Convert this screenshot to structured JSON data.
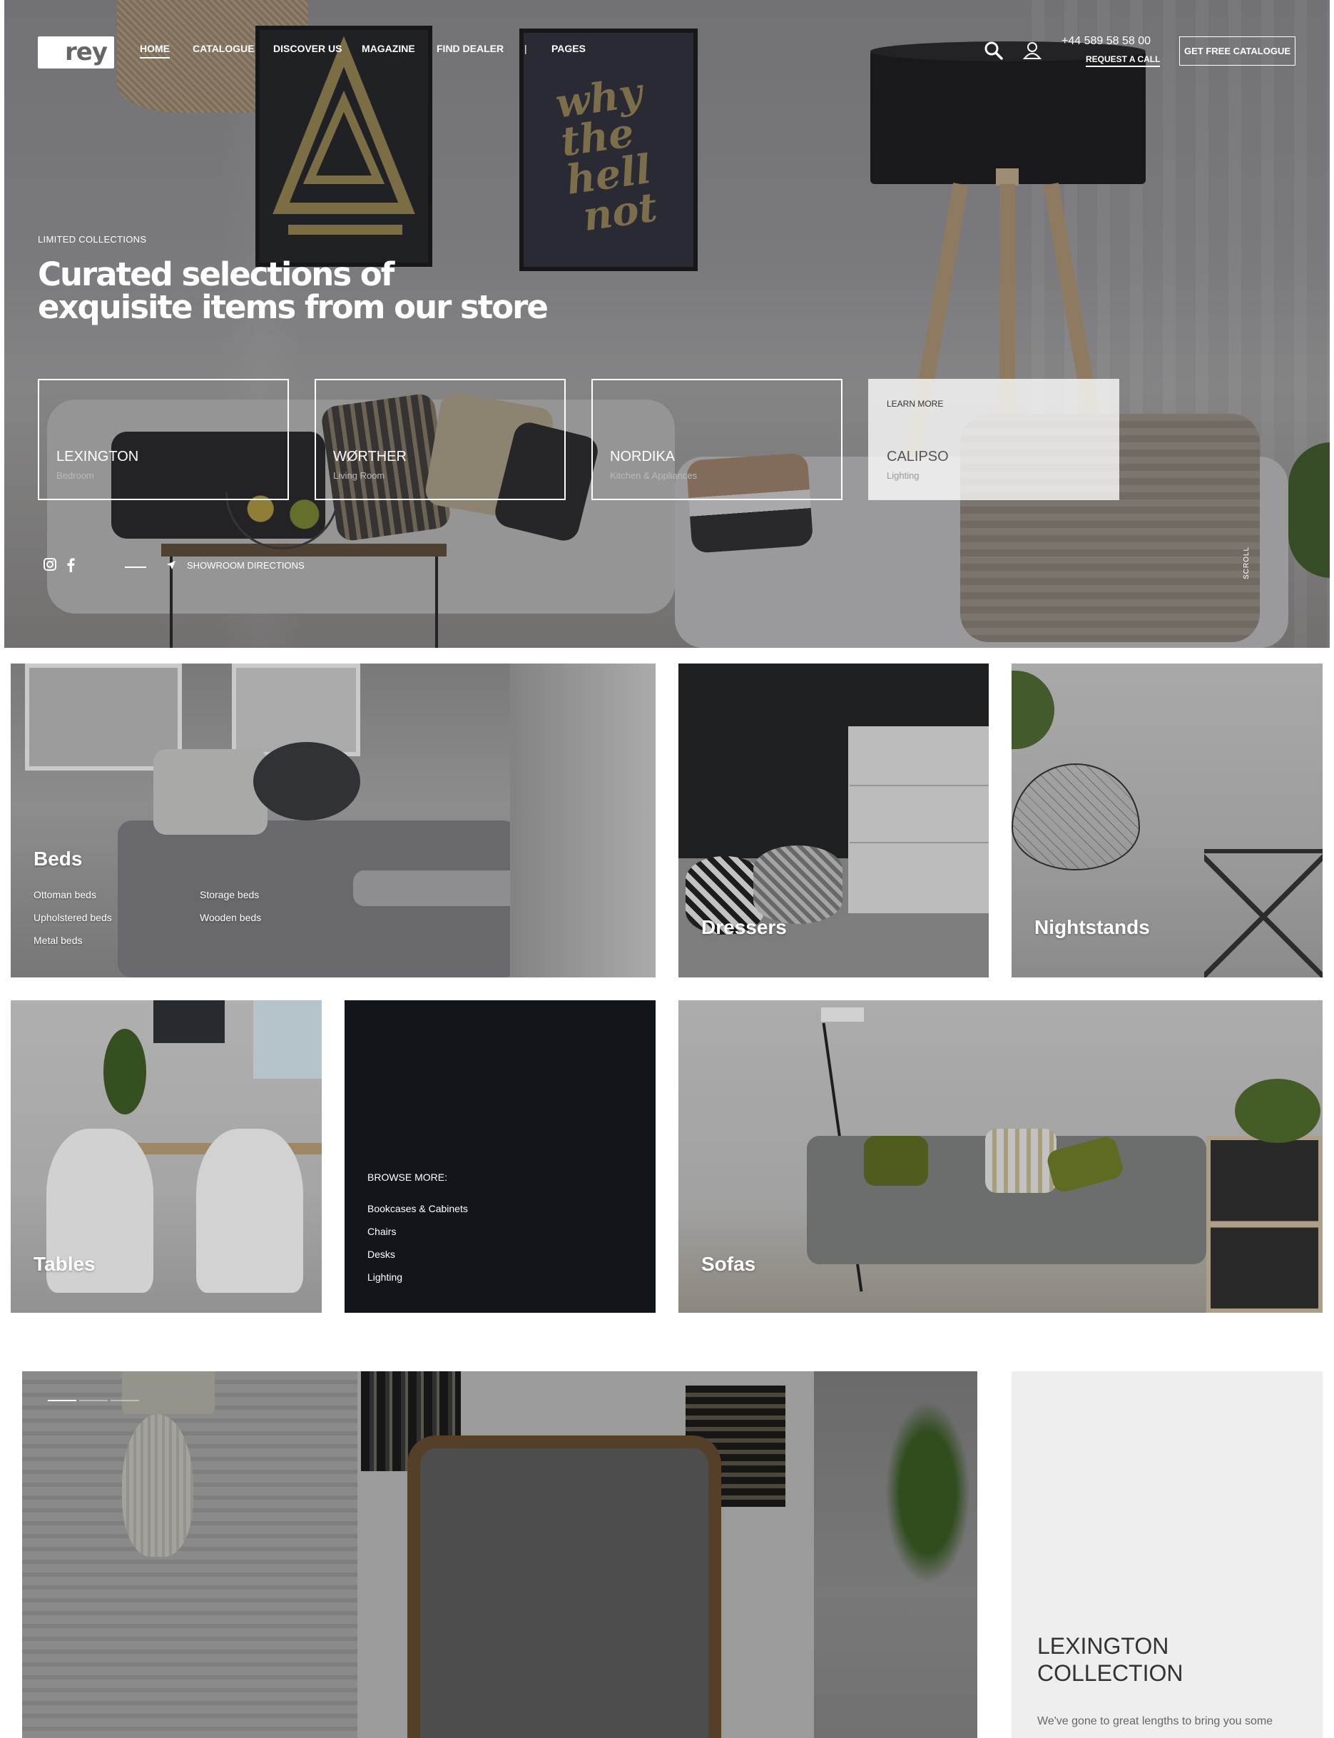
{
  "brand": {
    "logo_text": "rey"
  },
  "nav": {
    "items": [
      "HOME",
      "CATALOGUE",
      "DISCOVER US",
      "MAGAZINE",
      "FIND DEALER",
      "|",
      "PAGES"
    ],
    "active": "HOME"
  },
  "header": {
    "phone": "+44 589 58 58 00",
    "request_call": "REQUEST A CALL",
    "catalogue_button": "GET FREE CATALOGUE",
    "icons": [
      "search-icon",
      "user-icon"
    ]
  },
  "hero": {
    "tagline": "LIMITED COLLECTIONS",
    "headline": "Curated selections of exquisite items from our store",
    "cards": [
      {
        "title": "LEXINGTON",
        "subtitle": "Bedroom"
      },
      {
        "title": "WØRTHER",
        "subtitle": "Living Room"
      },
      {
        "title": "NORDIKA",
        "subtitle": "Kitchen & Appliances"
      },
      {
        "title": "CALIPSO",
        "subtitle": "Lighting",
        "learn_more": "LEARN MORE"
      }
    ],
    "social_icons": [
      "instagram-icon",
      "facebook-icon"
    ],
    "showroom": "SHOWROOM DIRECTIONS",
    "scroll": "SCROLL",
    "poster_text": [
      "why",
      "the",
      "hell",
      "not"
    ]
  },
  "categories": {
    "beds": {
      "title": "Beds",
      "links": [
        "Ottoman beds",
        "Storage beds",
        "Upholstered beds",
        "Wooden beds",
        "Metal beds"
      ]
    },
    "dressers": {
      "title": "Dressers"
    },
    "nightstands": {
      "title": "Nightstands"
    },
    "tables": {
      "title": "Tables"
    },
    "browse_more": {
      "heading": "BROWSE MORE:",
      "links": [
        "Bookcases & Cabinets",
        "Chairs",
        "Desks",
        "Lighting"
      ]
    },
    "sofas": {
      "title": "Sofas"
    }
  },
  "collection": {
    "title": "LEXINGTON COLLECTION",
    "description": "We've gone to great lengths to bring you some"
  }
}
